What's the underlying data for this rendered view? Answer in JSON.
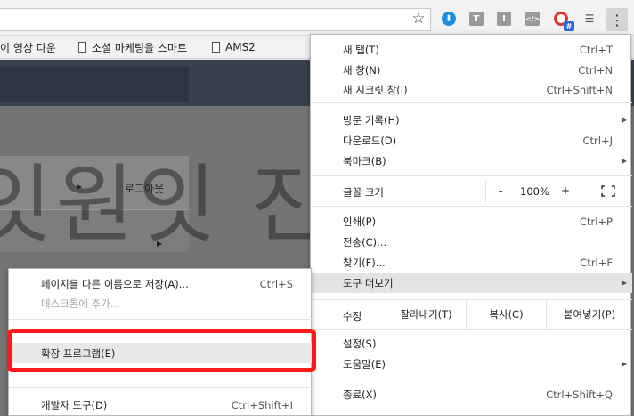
{
  "bookmarks": [
    {
      "label": "이 영상 다운"
    },
    {
      "label": "소셜 마케팅을 스마트"
    },
    {
      "label": "AMS2"
    }
  ],
  "page": {
    "logout_label": "로그아웃"
  },
  "watermark": "잇원잇 진짜블",
  "menu": {
    "new_tab": {
      "label": "새 탭(T)",
      "shortcut": "Ctrl+T"
    },
    "new_window": {
      "label": "새 창(N)",
      "shortcut": "Ctrl+N"
    },
    "incognito": {
      "label": "새 시크릿 창(I)",
      "shortcut": "Ctrl+Shift+N"
    },
    "history": {
      "label": "방문 기록(H)"
    },
    "downloads": {
      "label": "다운로드(D)",
      "shortcut": "Ctrl+J"
    },
    "bookmarks": {
      "label": "북마크(B)"
    },
    "zoom": {
      "label": "글꼴 크기",
      "minus": "-",
      "value": "100%",
      "plus": "+"
    },
    "print": {
      "label": "인쇄(P)",
      "shortcut": "Ctrl+P"
    },
    "cast": {
      "label": "전송(C)..."
    },
    "find": {
      "label": "찾기(F)...",
      "shortcut": "Ctrl+F"
    },
    "more_tools": {
      "label": "도구 더보기"
    },
    "edit": {
      "label": "수정",
      "cut": "잘라내기(T)",
      "copy": "복사(C)",
      "paste": "붙여넣기(P)"
    },
    "settings": {
      "label": "설정(S)"
    },
    "help": {
      "label": "도움말(E)"
    },
    "exit": {
      "label": "종료(X)",
      "shortcut": "Ctrl+Shift+Q"
    }
  },
  "submenu": {
    "save_page": {
      "label": "페이지를 다른 이름으로 저장(A)...",
      "shortcut": "Ctrl+S"
    },
    "add_to_desktop": {
      "label": "데스크톱에 추가..."
    },
    "extensions": {
      "label": "확장 프로그램(E)"
    },
    "devtools": {
      "label": "개발자 도구(D)",
      "shortcut": "Ctrl+Shift+I"
    }
  },
  "colors": {
    "highlight": "#ff1a1a",
    "menu_bg": "#ffffff",
    "toolbar_bg": "#f2f2f2"
  }
}
